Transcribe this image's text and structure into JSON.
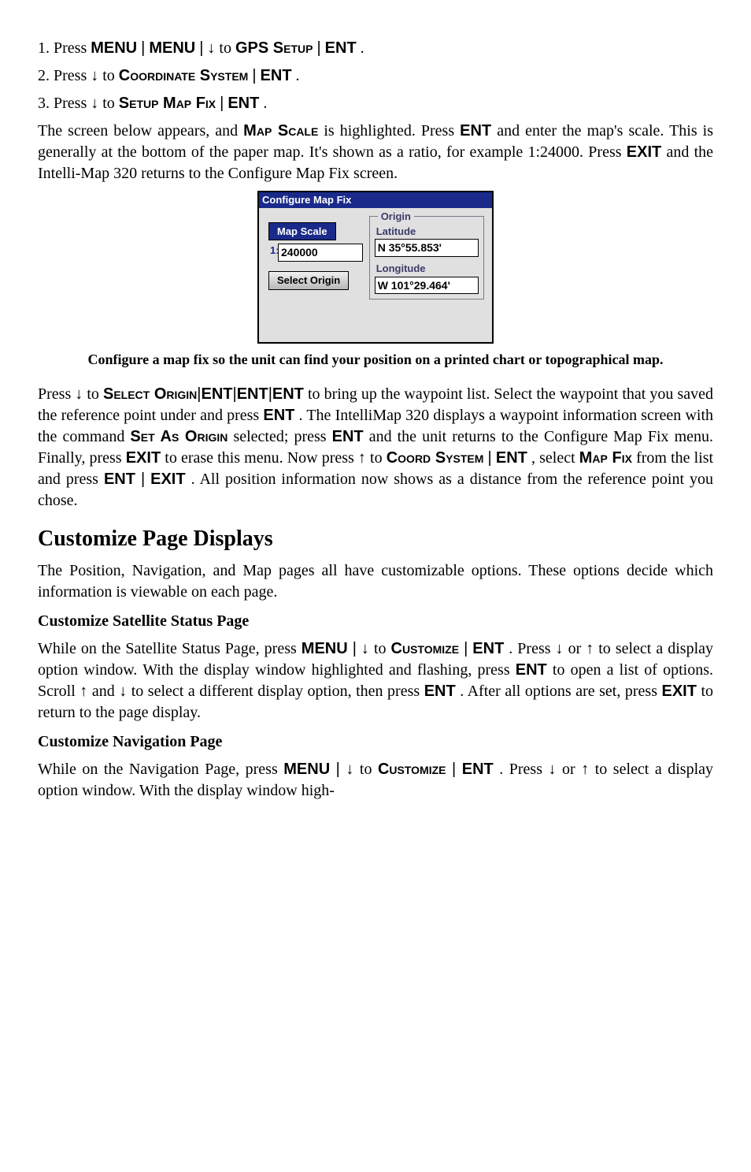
{
  "steps": {
    "s1": {
      "text_a": "1. Press ",
      "menu": "MENU",
      "pipe": "|",
      "arrow_down": "↓",
      "to": " to ",
      "gps_setup": "GPS Setup",
      "ent": "ENT",
      "period": "."
    },
    "s2": {
      "text_a": "2. Press ",
      "arrow_down": "↓",
      "to": " to ",
      "coord": "Coordinate System",
      "pipe": "|",
      "ent": "ENT",
      "period": "."
    },
    "s3": {
      "text_a": "3. Press ",
      "arrow_down": "↓",
      "to": " to ",
      "setup": "Setup Map Fix",
      "pipe": "|",
      "ent": "ENT",
      "period": "."
    }
  },
  "para1": {
    "a": "The screen below appears, and ",
    "map_scale": "Map Scale",
    "b": " is highlighted. Press ",
    "ent": "ENT",
    "c": " and enter the map's scale. This is generally at the bottom of the paper map. It's shown as a ratio, for example 1:24000. Press ",
    "exit": "EXIT",
    "d": " and the Intelli-Map 320 returns to the Configure Map Fix screen."
  },
  "screenshot": {
    "title": "Configure Map Fix",
    "map_scale_btn": "Map Scale",
    "idx": "1:",
    "scale_value": "240000",
    "select_origin_btn": "Select Origin",
    "origin_legend": "Origin",
    "lat_label": "Latitude",
    "lat_value": "N   35°55.853'",
    "lon_label": "Longitude",
    "lon_value": "W 101°29.464'"
  },
  "caption": "Configure a map fix so the unit can find your position on a printed chart or topographical map.",
  "para2": {
    "a": "Press ",
    "down": "↓",
    "b": " to ",
    "scO": "Select Origin",
    "ent": "ENT",
    "c": " to bring up the waypoint list. Select the waypoint that you saved the reference point under and press ",
    "d": ". The IntelliMap 320 displays a waypoint information screen with the command ",
    "setas": "Set As Origin",
    "e": " selected; press ",
    "f": " and the unit returns to the Configure Map Fix menu. Finally, press ",
    "exit": "EXIT",
    "g": " to erase this menu. Now press ",
    "up": "↑",
    "h": " to ",
    "coord": "Coord System",
    "pipe": "|",
    "i": ", select ",
    "mapfix": "Map Fix",
    "j": " from the list and press ",
    "k": ". All position information now shows as a distance from the reference point you chose."
  },
  "h2": "Customize Page Displays",
  "para3": "The Position, Navigation, and Map pages all have customizable options. These options decide which information is viewable on each page.",
  "sub1": "Customize Satellite Status Page",
  "para4": {
    "a": "While on the Satellite Status Page, press ",
    "menu": "MENU",
    "pipe": "|",
    "down": "↓",
    "b": " to ",
    "cust": "Customize",
    "ent": "ENT",
    "c": ". Press ",
    "d": " or ",
    "up": "↑",
    "e": " to select a display option window. With the display window highlighted and flashing, press ",
    "f": " to open a list of options. Scroll ",
    "g": " and ",
    "h": " to select a different display option, then press ",
    "i": ". After all options are set, press ",
    "exit": "EXIT",
    "j": " to return to the page display."
  },
  "sub2": "Customize Navigation Page",
  "para5": {
    "a": "While on the Navigation Page, press ",
    "menu": "MENU",
    "pipe": "|",
    "down": "↓",
    "b": " to ",
    "cust": "Customize",
    "ent": "ENT",
    "c": ". Press ",
    "d": " or ",
    "up": "↑",
    "e": " to select a display option window. With the display window high-"
  }
}
